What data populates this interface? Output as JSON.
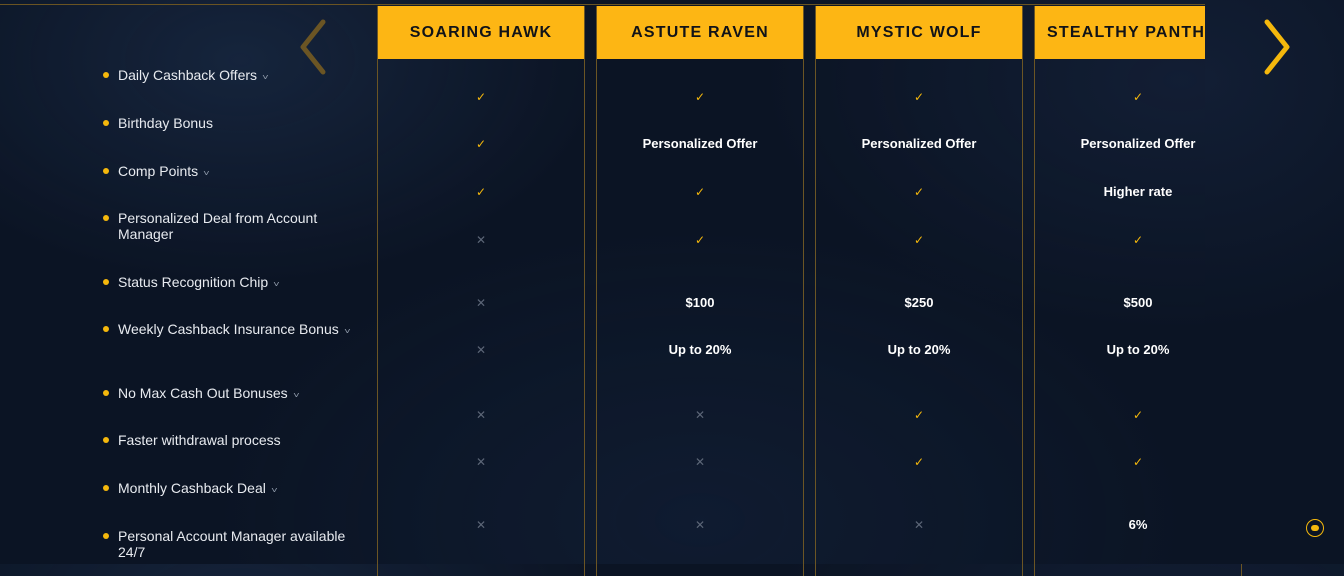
{
  "nav": {
    "prev_icon": "chevron-left-icon",
    "next_icon": "chevron-right-icon",
    "prev_color": "#6b5524",
    "next_color": "#f5b80c"
  },
  "features": [
    {
      "label": "Daily Cashback Offers",
      "expandable": true
    },
    {
      "label": "Birthday Bonus",
      "expandable": false
    },
    {
      "label": "Comp Points",
      "expandable": true
    },
    {
      "label": "Personalized Deal from Account Manager",
      "expandable": false
    },
    {
      "label": "Status Recognition Chip",
      "expandable": true
    },
    {
      "label": "Weekly Cashback Insurance Bonus",
      "expandable": true
    },
    {
      "label": "No Max Cash Out Bonuses",
      "expandable": true
    },
    {
      "label": "Faster withdrawal process",
      "expandable": false
    },
    {
      "label": "Monthly Cashback Deal",
      "expandable": true
    },
    {
      "label": "Personal Account Manager available 24/7",
      "expandable": false
    }
  ],
  "tiers": [
    {
      "name": "SOARING HAWK",
      "cells": [
        {
          "type": "check"
        },
        {
          "type": "check"
        },
        {
          "type": "check"
        },
        {
          "type": "cross"
        },
        {
          "type": "cross"
        },
        {
          "type": "cross"
        },
        {
          "type": "cross"
        },
        {
          "type": "cross"
        },
        {
          "type": "cross"
        }
      ]
    },
    {
      "name": "ASTUTE RAVEN",
      "cells": [
        {
          "type": "check"
        },
        {
          "type": "text",
          "value": "Personalized Offer"
        },
        {
          "type": "check"
        },
        {
          "type": "check"
        },
        {
          "type": "text",
          "value": "$100"
        },
        {
          "type": "text",
          "value": "Up to 20%"
        },
        {
          "type": "cross"
        },
        {
          "type": "cross"
        },
        {
          "type": "cross"
        }
      ]
    },
    {
      "name": "MYSTIC WOLF",
      "cells": [
        {
          "type": "check"
        },
        {
          "type": "text",
          "value": "Personalized Offer"
        },
        {
          "type": "check"
        },
        {
          "type": "check"
        },
        {
          "type": "text",
          "value": "$250"
        },
        {
          "type": "text",
          "value": "Up to 20%"
        },
        {
          "type": "check"
        },
        {
          "type": "check"
        },
        {
          "type": "cross"
        }
      ]
    },
    {
      "name": "STEALTHY PANTH",
      "cells": [
        {
          "type": "check"
        },
        {
          "type": "text",
          "value": "Personalized Offer"
        },
        {
          "type": "text",
          "value": "Higher rate"
        },
        {
          "type": "check"
        },
        {
          "type": "text",
          "value": "$500"
        },
        {
          "type": "text",
          "value": "Up to 20%"
        },
        {
          "type": "check"
        },
        {
          "type": "check"
        },
        {
          "type": "text",
          "value": "6%"
        }
      ]
    }
  ],
  "colors": {
    "accent": "#fdb614",
    "background": "#0b1424",
    "check": "#f5b80c",
    "cross": "#5c6677",
    "border": "#6b5524"
  },
  "chat": {
    "icon": "chat-icon"
  }
}
